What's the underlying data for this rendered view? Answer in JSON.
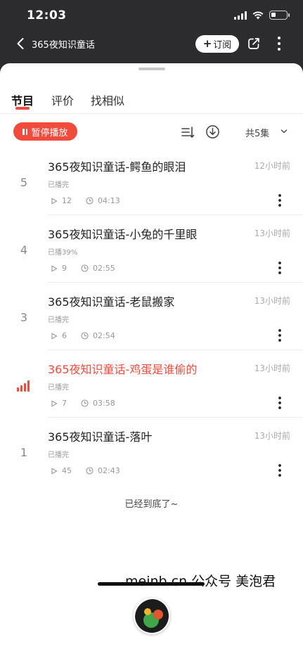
{
  "status_bar": {
    "time": "12:03"
  },
  "header": {
    "title": "365夜知识童话",
    "subscribe_label": "订阅"
  },
  "tabs": [
    {
      "label": "节目",
      "active": true
    },
    {
      "label": "评价",
      "active": false
    },
    {
      "label": "找相似",
      "active": false
    }
  ],
  "toolbar": {
    "pause_label": "暂停播放",
    "count_label": "共5集"
  },
  "episodes": [
    {
      "number": "5",
      "title": "365夜知识童话-鳄鱼的眼泪",
      "time": "12小时前",
      "status": "已播完",
      "plays": "12",
      "duration": "04:13",
      "playing": false
    },
    {
      "number": "4",
      "title": "365夜知识童话-小兔的千里眼",
      "time": "13小时前",
      "status": "已播39%",
      "plays": "9",
      "duration": "02:55",
      "playing": false
    },
    {
      "number": "3",
      "title": "365夜知识童话-老鼠搬家",
      "time": "13小时前",
      "status": "已播完",
      "plays": "6",
      "duration": "02:54",
      "playing": false
    },
    {
      "number": "",
      "title": "365夜知识童话-鸡蛋是谁偷的",
      "time": "13小时前",
      "status": "已播完",
      "plays": "7",
      "duration": "03:58",
      "playing": true
    },
    {
      "number": "1",
      "title": "365夜知识童话-落叶",
      "time": "13小时前",
      "status": "已播完",
      "plays": "45",
      "duration": "02:43",
      "playing": false
    }
  ],
  "end_text": "已经到底了~",
  "watermark": "meinb.cn 公众号 美泡君",
  "colors": {
    "accent": "#f04b3d",
    "header_bg": "#2c2c2e"
  }
}
